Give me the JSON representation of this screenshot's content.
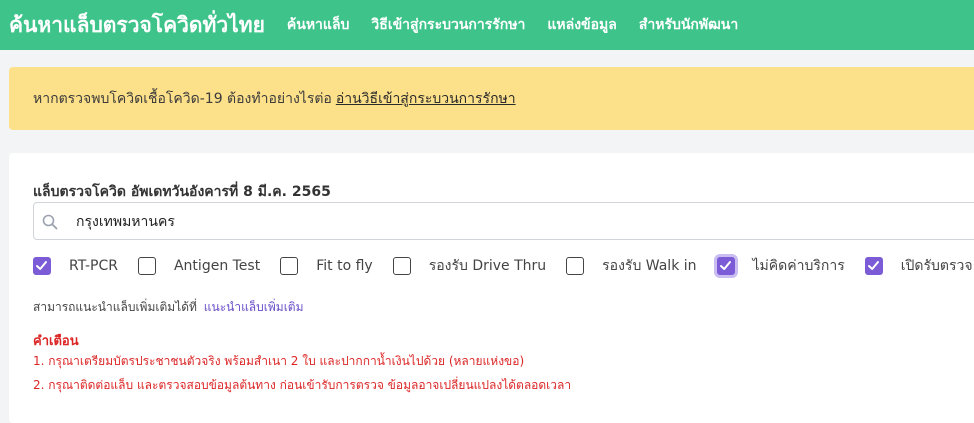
{
  "navbar": {
    "brand": "ค้นหาแล็บตรวจโควิดทั่วไทย",
    "links": [
      "ค้นหาแล็บ",
      "วิธีเข้าสู่กระบวนการรักษา",
      "แหล่งข้อมูล",
      "สำหรับนักพัฒนา"
    ]
  },
  "alert": {
    "text": "หากตรวจพบโควิดเชื้อโควิด-19 ต้องทำอย่างไรต่อ",
    "link": "อ่านวิธีเข้าสู่กระบวนการรักษา"
  },
  "main": {
    "heading": "แล็บตรวจโควิด อัพเดทวันอังคารที่ 8 มี.ค. 2565",
    "search": {
      "value": "กรุงเทพมหานคร",
      "icon": "search-icon"
    },
    "filters": [
      {
        "label": "RT-PCR",
        "checked": true
      },
      {
        "label": "Antigen Test",
        "checked": false
      },
      {
        "label": "Fit to fly",
        "checked": false
      },
      {
        "label": "รองรับ Drive Thru",
        "checked": false
      },
      {
        "label": "รองรับ Walk in",
        "checked": false
      },
      {
        "label": "ไม่คิดค่าบริการ",
        "checked": true
      },
      {
        "label": "เปิดรับตรวจ",
        "checked": true
      }
    ],
    "suggest_text": "สามารถแนะนำแล็บเพิ่มเติมได้ที่",
    "suggest_link": "แนะนำแล็บเพิ่มเติม",
    "warning_title": "คำเตือน",
    "warnings": [
      "1. กรุณาเตรียมบัตรประชาชนตัวจริง พร้อมสำเนา 2 ใบ และปากกาน้ำเงินไปด้วย (หลายแห่งขอ)",
      "2. กรุณาติดต่อแล็บ และตรวจสอบข้อมูลต้นทาง ก่อนเข้ารับการตรวจ ข้อมูลอาจเปลี่ยนแปลงได้ตลอดเวลา"
    ]
  },
  "colors": {
    "navbar": "#3ec48b",
    "alert": "#fde08a",
    "checkbox_accent": "#7b5cd6",
    "warning": "#dc2626"
  }
}
